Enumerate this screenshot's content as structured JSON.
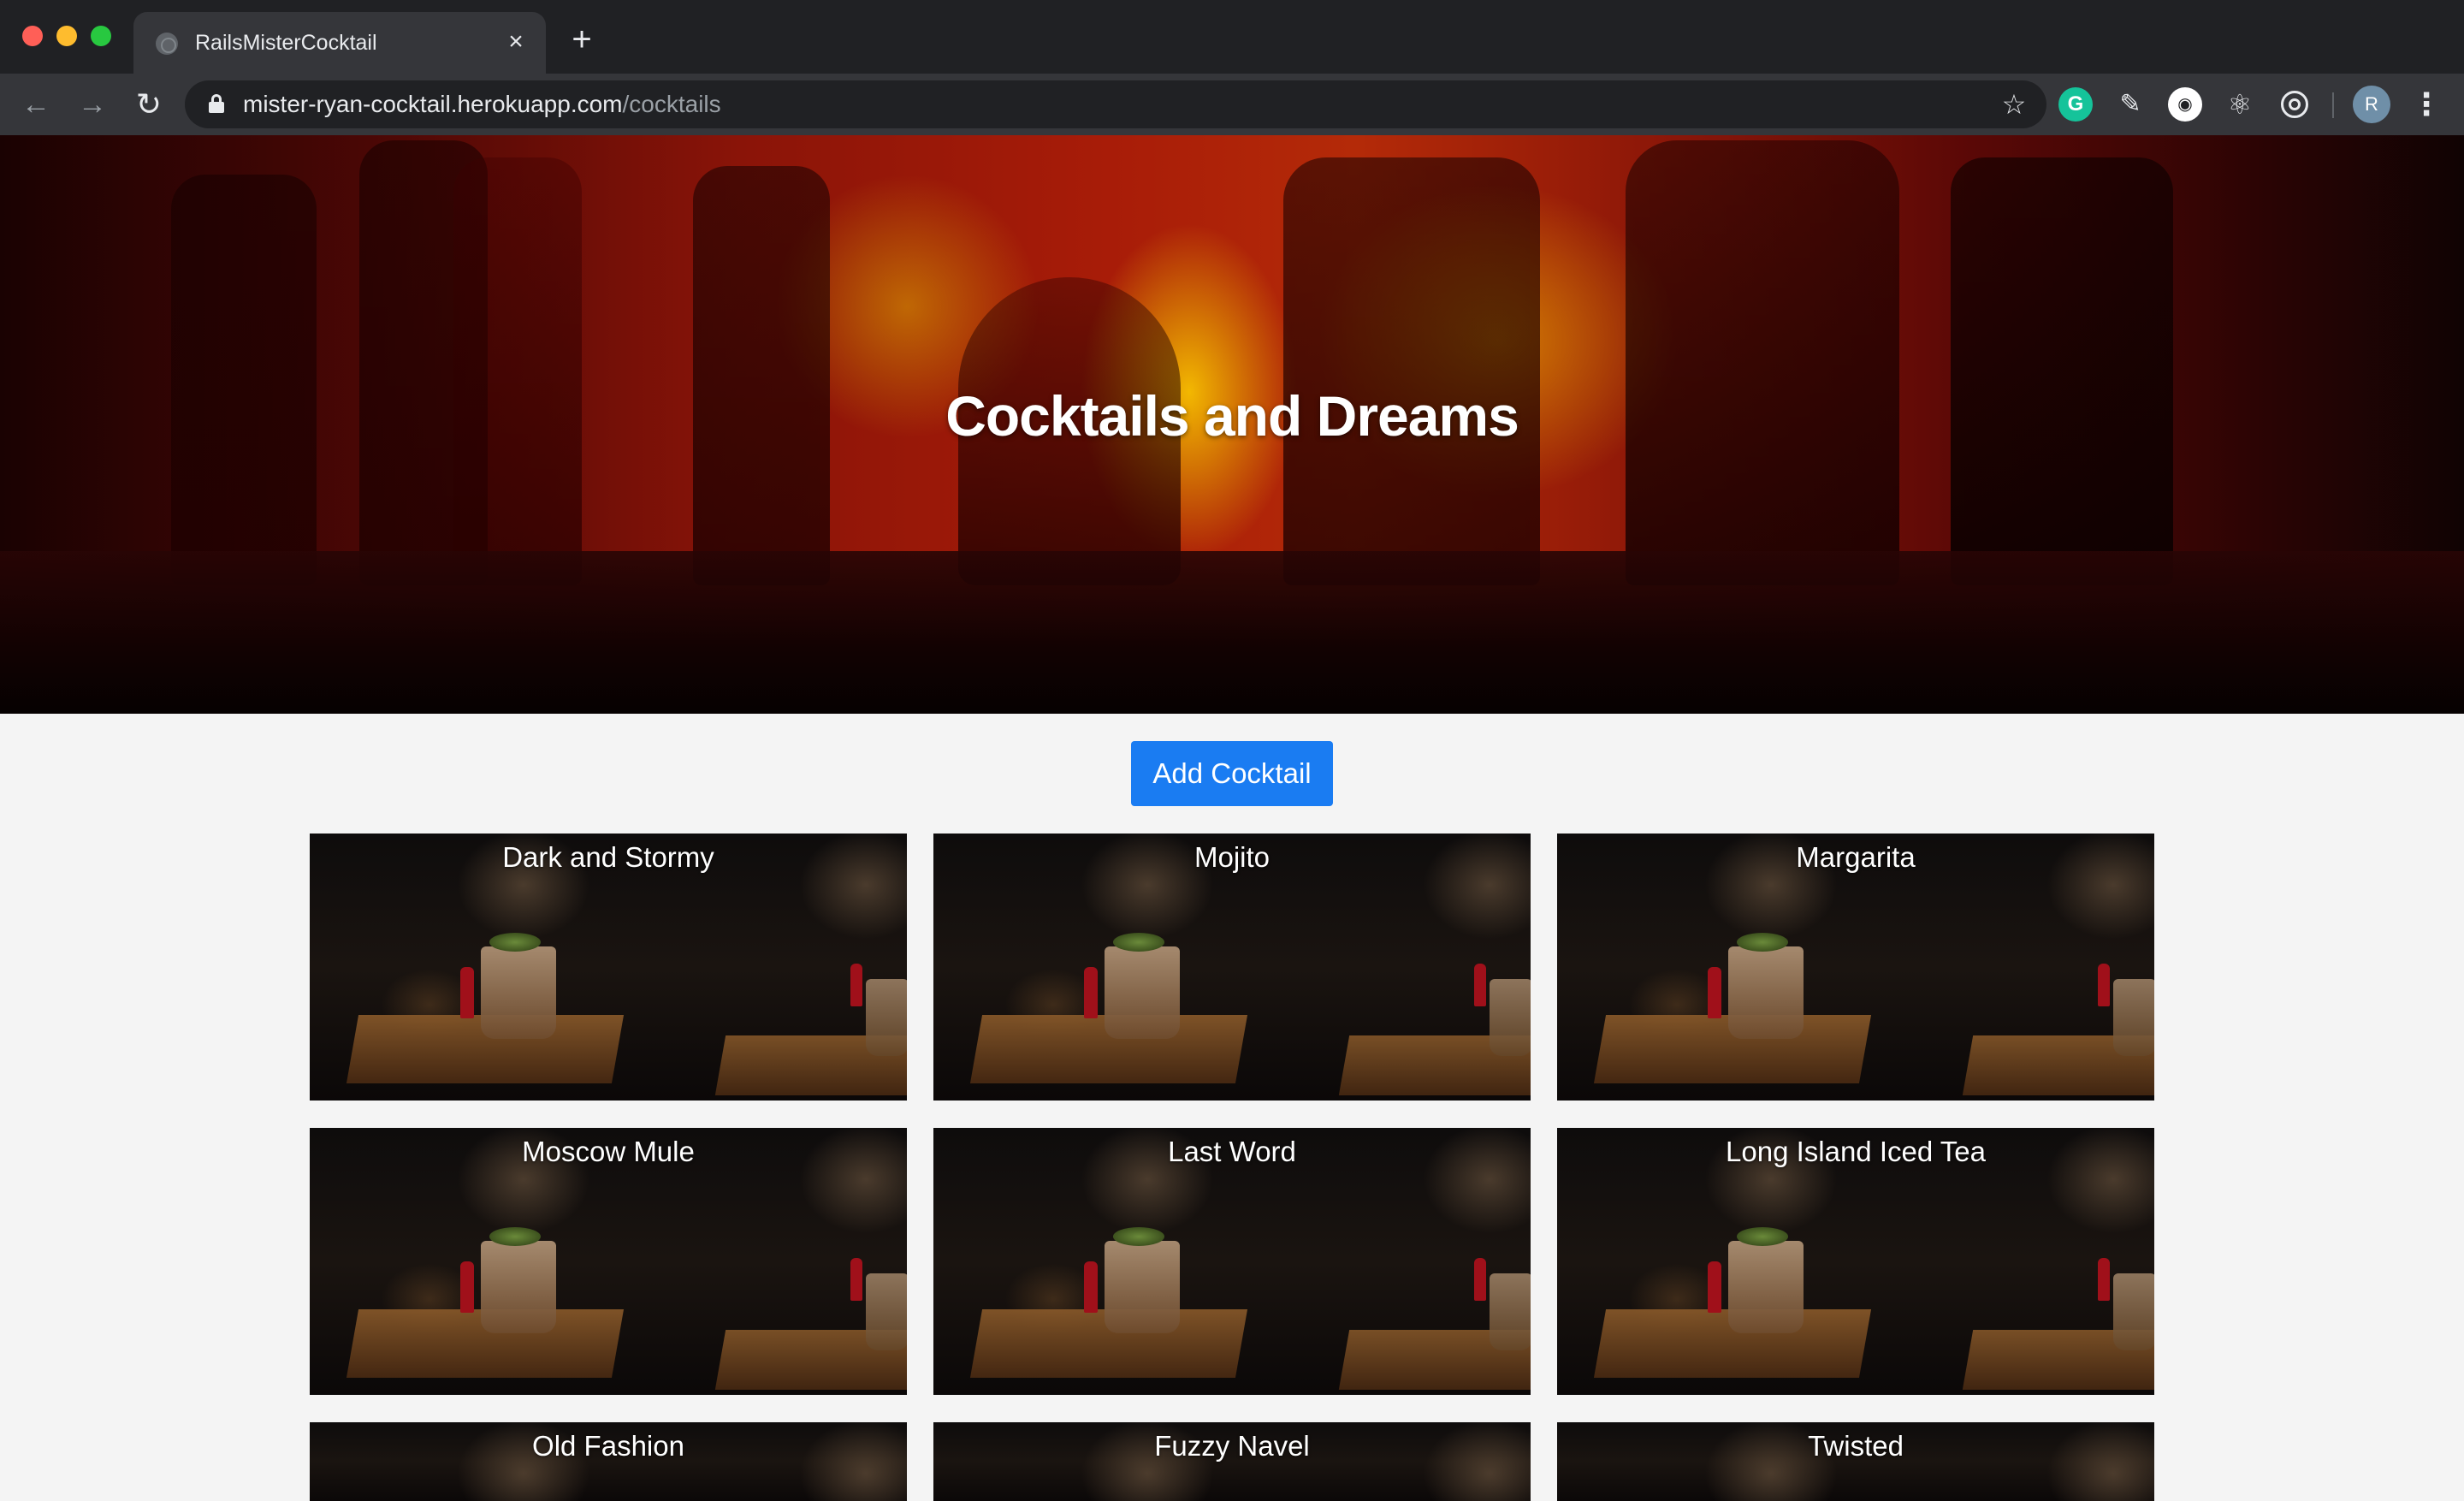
{
  "browser": {
    "tab_title": "RailsMisterCocktail",
    "tab_close": "×",
    "new_tab": "+",
    "url_host": "mister-ryan-cocktail.herokuapp.com",
    "url_path": "/cocktails",
    "avatar_initial": "R",
    "icons": {
      "back": "←",
      "forward": "→",
      "reload": "↻",
      "star": "☆",
      "grammarly": "G",
      "pen": "✎",
      "round": "◉",
      "react": "⚛",
      "menu": "⋮"
    }
  },
  "hero": {
    "title": "Cocktails and Dreams"
  },
  "actions": {
    "add_label": "Add Cocktail"
  },
  "cocktails": [
    {
      "name": "Dark and Stormy"
    },
    {
      "name": "Mojito"
    },
    {
      "name": "Margarita"
    },
    {
      "name": "Moscow Mule"
    },
    {
      "name": "Last Word"
    },
    {
      "name": "Long Island Iced Tea"
    },
    {
      "name": "Old Fashion"
    },
    {
      "name": "Fuzzy Navel"
    },
    {
      "name": "Twisted"
    }
  ],
  "colors": {
    "accent": "#1a7cf2",
    "page_bg": "#f4f4f4",
    "chrome_bg": "#202124"
  }
}
